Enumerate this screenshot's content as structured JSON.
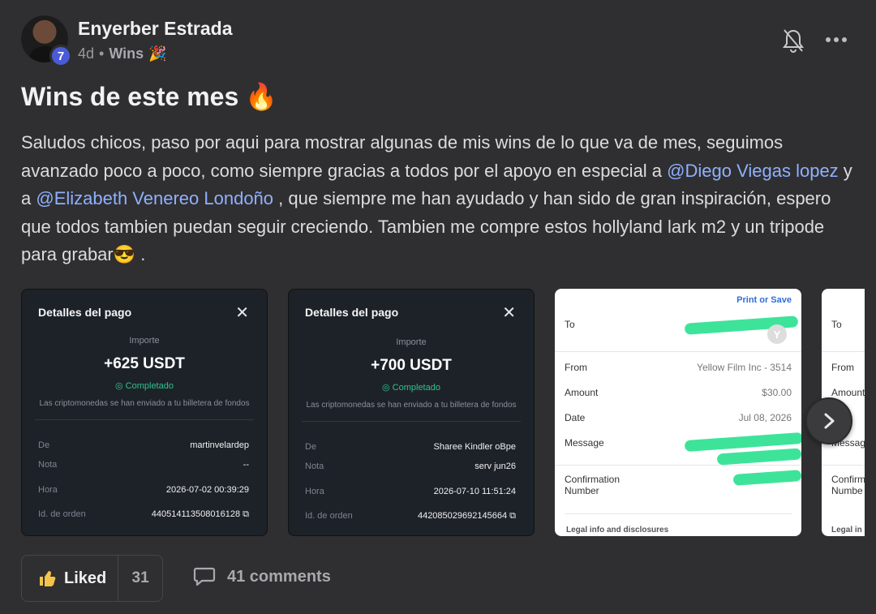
{
  "author": {
    "name": "Enyerber Estrada",
    "level": "7"
  },
  "meta": {
    "time": "4d",
    "sep": "•",
    "category": "Wins",
    "category_emoji": "🎉"
  },
  "post": {
    "title": "Wins de este mes",
    "title_emoji": "🔥",
    "body": [
      {
        "t": "Saludos chicos, paso por aqui para mostrar algunas de mis wins de lo que va de mes, seguimos avanzado poco a poco, como siempre gracias a todos por el apoyo en especial a "
      },
      {
        "t": "@Diego Viegas lopez",
        "mention": true
      },
      {
        "t": " y a "
      },
      {
        "t": "@Elizabeth Venereo Londoño",
        "mention": true
      },
      {
        "t": " , que siempre me han ayudado y han sido de gran inspiración, espero que todos tambien puedan seguir creciendo. Tambien me compre estos hollyland lark m2 y un tripode para grabar😎 ."
      }
    ]
  },
  "cards": [
    {
      "header": "Detalles del pago",
      "close": "✕",
      "amount_label": "Importe",
      "amount": "+625 USDT",
      "status": "Completado",
      "note": "Las criptomonedas se han enviado a tu billetera de fondos",
      "rows": [
        {
          "k": "De",
          "v": "martinvelardep"
        },
        {
          "k": "Nota",
          "v": "--"
        },
        {
          "k": "Hora",
          "v": "2026-07-02 00:39:29"
        },
        {
          "k": "Id. de orden",
          "v": "440514113508016128"
        }
      ]
    },
    {
      "header": "Detalles del pago",
      "close": "✕",
      "amount_label": "Importe",
      "amount": "+700 USDT",
      "status": "Completado",
      "note": "Las criptomonedas se han enviado a tu billetera de fondos",
      "rows": [
        {
          "k": "De",
          "v": "Sharee Kindler oBpe"
        },
        {
          "k": "Nota",
          "v": "serv jun26"
        },
        {
          "k": "Hora",
          "v": "2026-07-10 11:51:24"
        },
        {
          "k": "Id. de orden",
          "v": "442085029692145664"
        }
      ]
    }
  ],
  "receipt": {
    "print": "Print or Save",
    "to": "To",
    "to_avatar": "Y",
    "from": "From",
    "from_value": "Yellow Film Inc - 3514",
    "amount": "Amount",
    "amount_value": "$30.00",
    "date": "Date",
    "date_value": "Jul 08, 2026",
    "message": "Message",
    "confirmation": "Confirmation Number",
    "legal": "Legal info and disclosures"
  },
  "receipt2": {
    "to": "To",
    "from": "From",
    "amount": "Amount",
    "message": "Message",
    "confirmation": "Confirm Numbe",
    "legal": "Legal in"
  },
  "actions": {
    "like_label": "Liked",
    "like_count": "31",
    "comments_label": "41 comments"
  },
  "colors": {
    "mention": "#8fb0ff",
    "accent": "#4a5bd8",
    "success": "#30c28a",
    "link": "#2d6fd6",
    "redaction": "#3ee39a"
  }
}
